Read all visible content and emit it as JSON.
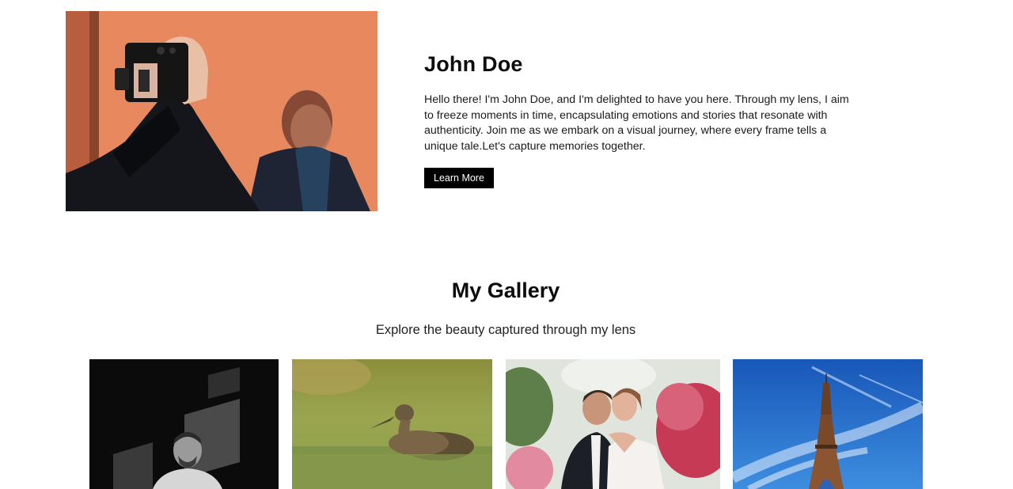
{
  "hero": {
    "title": "John Doe",
    "bio": "Hello there! I'm John Doe, and I'm delighted to have you here. Through my lens, I aim to freeze moments in time, encapsulating emotions and stories that resonate with authenticity. Join me as we embark on a visual journey, where every frame tells a unique tale.Let's capture memories together.",
    "button_label": "Learn More",
    "image": "photographer-with-camera-photo"
  },
  "gallery": {
    "title": "My Gallery",
    "subtitle": "Explore the beauty captured through my lens",
    "images": [
      "black-and-white-portrait",
      "duck-on-water",
      "wedding-couple",
      "eiffel-tower-blue-sky"
    ]
  },
  "colors": {
    "button_bg": "#000000",
    "button_text": "#ffffff",
    "background": "#ffffff"
  }
}
